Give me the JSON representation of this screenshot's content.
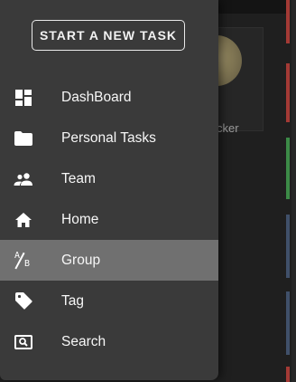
{
  "background": {
    "card_name_fragment": "cker",
    "column_colors": [
      "#a33a35",
      "#a33a35",
      "#3c8a47",
      "#40506a",
      "#40506a",
      "#a33a35"
    ]
  },
  "drawer": {
    "new_task_label": "START A NEW TASK",
    "menu": [
      {
        "label": "DashBoard",
        "icon": "dashboard-icon",
        "active": false
      },
      {
        "label": "Personal Tasks",
        "icon": "folder-icon",
        "active": false
      },
      {
        "label": "Team",
        "icon": "people-icon",
        "active": false
      },
      {
        "label": "Home",
        "icon": "home-icon",
        "active": false
      },
      {
        "label": "Group",
        "icon": "a-b-icon",
        "active": true
      },
      {
        "label": "Tag",
        "icon": "tag-icon",
        "active": false
      },
      {
        "label": "Search",
        "icon": "search-icon",
        "active": false
      }
    ]
  },
  "colors": {
    "drawer_bg": "#3a3a3a",
    "active_item_bg": "#707070",
    "text": "#ffffff"
  }
}
